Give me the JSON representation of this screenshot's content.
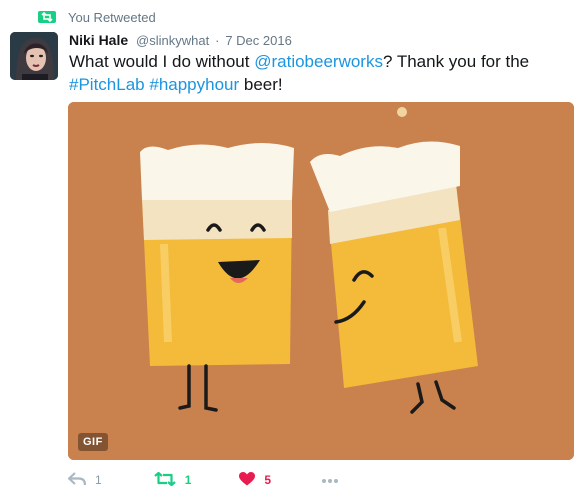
{
  "retweet_context": {
    "label": "You Retweeted",
    "icon": "retweet-icon"
  },
  "author": {
    "name": "Niki Hale",
    "handle": "@slinkywhat",
    "separator": "·",
    "date": "7 Dec 2016"
  },
  "tweet": {
    "text_before": "What would I do without ",
    "mention": "@ratiobeerworks",
    "text_middle": "? Thank you for the ",
    "hashtag1": "#PitchLab",
    "space": " ",
    "hashtag2": "#happyhour",
    "text_after": " beer!"
  },
  "media": {
    "badge": "GIF",
    "background_color": "#c9824e"
  },
  "actions": {
    "reply": {
      "icon": "reply-icon",
      "count": "1"
    },
    "retweet": {
      "icon": "retweet-icon",
      "count": "1",
      "color": "#19cf86"
    },
    "like": {
      "icon": "heart-icon",
      "count": "5",
      "color": "#e81c4f"
    },
    "more": {
      "icon": "more-icon"
    }
  }
}
